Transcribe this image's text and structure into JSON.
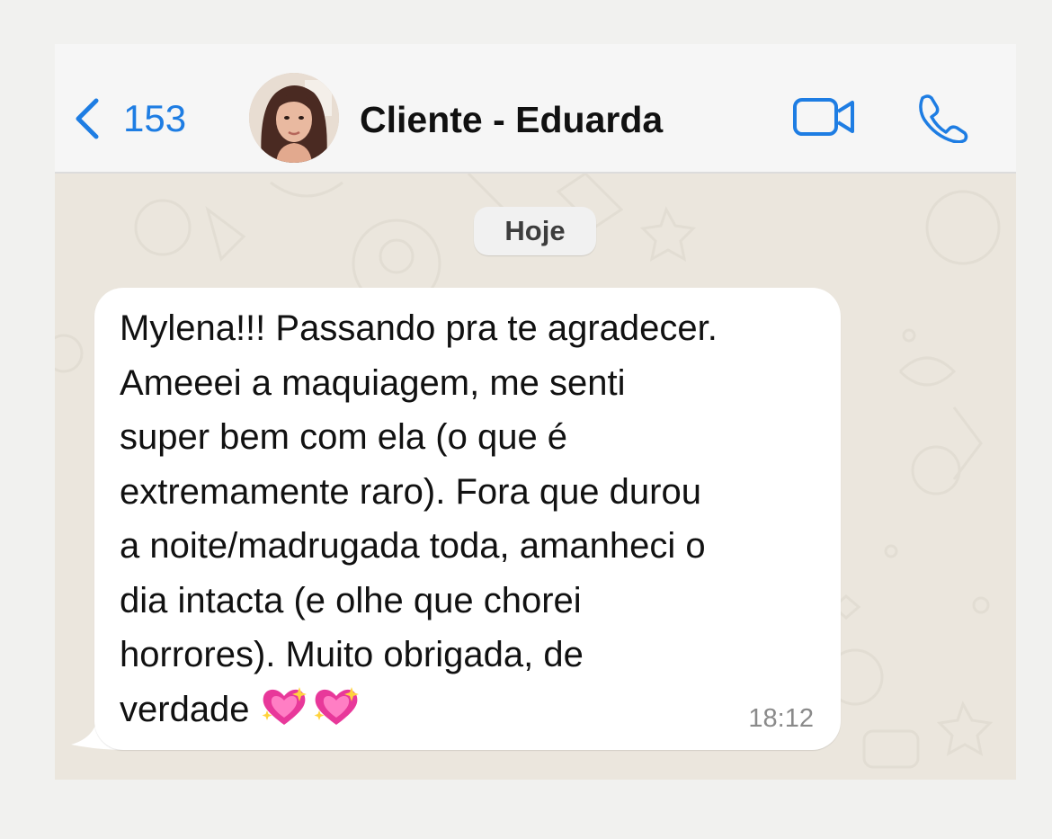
{
  "header": {
    "back_count": "153",
    "contact_name": "Cliente - Eduarda"
  },
  "chat": {
    "date_label": "Hoje",
    "message": {
      "text": "Mylena!!! Passando pra te agradecer.\nAmeeei a maquiagem, me senti\nsuper bem com ela (o que é\nextremamente raro). Fora que durou\na noite/madrugada toda, amanheci o\ndia intacta (e olhe que chorei\nhorrores). Muito obrigada, de\nverdade",
      "emojis": [
        "sparkling-heart-icon",
        "sparkling-heart-icon"
      ],
      "time": "18:12"
    }
  },
  "colors": {
    "accent": "#1e7de3",
    "chat_background": "#ebe6dd",
    "bubble": "#ffffff",
    "header": "#f6f6f6"
  }
}
